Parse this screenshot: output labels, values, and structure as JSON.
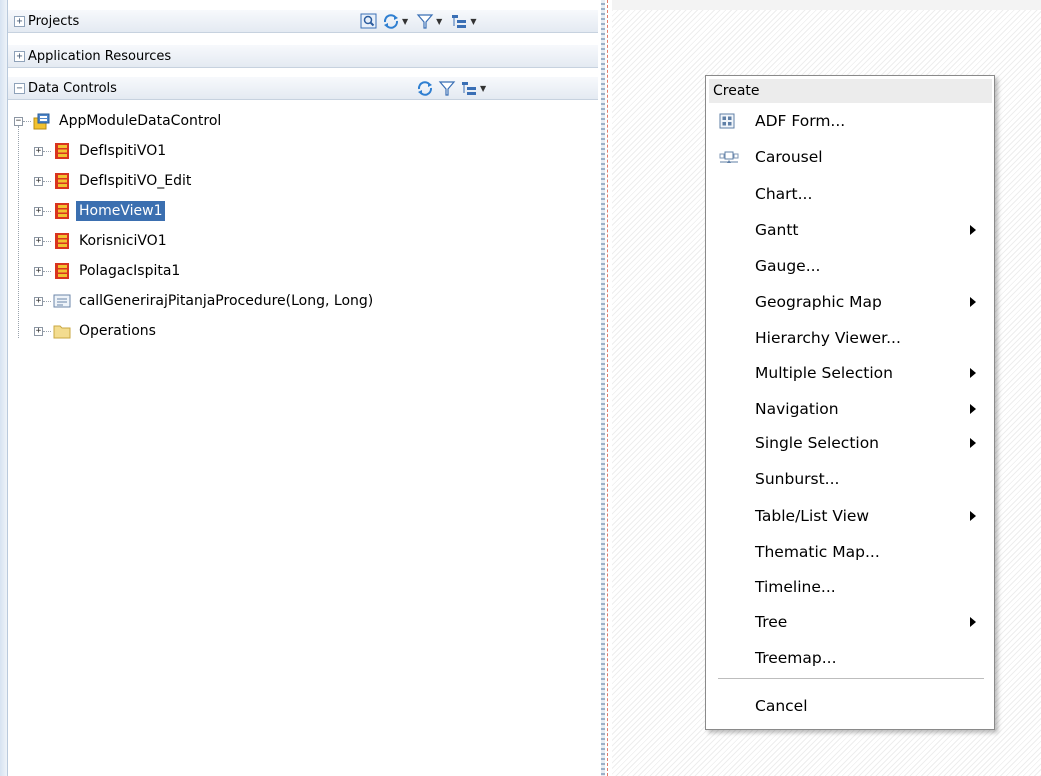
{
  "panels": {
    "projects": {
      "title": "Projects",
      "toggle": "+"
    },
    "app_resources": {
      "title": "Application Resources",
      "toggle": "+"
    },
    "data_controls": {
      "title": "Data Controls",
      "toggle": "−"
    }
  },
  "tree": {
    "root": {
      "label": "AppModuleDataControl",
      "expander": "−",
      "icon": "data-control-icon"
    },
    "children": [
      {
        "label": "DefIspitiVO1",
        "expander": "+",
        "icon": "view-object-icon"
      },
      {
        "label": "DefIspitiVO_Edit",
        "expander": "+",
        "icon": "view-object-icon"
      },
      {
        "label": "HomeView1",
        "expander": "+",
        "icon": "view-object-icon",
        "selected": true
      },
      {
        "label": "KorisniciVO1",
        "expander": "+",
        "icon": "view-object-icon"
      },
      {
        "label": "PolagacIspita1",
        "expander": "+",
        "icon": "view-object-icon"
      },
      {
        "label": "callGenerirajPitanjaProcedure(Long, Long)",
        "expander": "+",
        "icon": "method-icon"
      },
      {
        "label": "Operations",
        "expander": "+",
        "icon": "folder-icon"
      }
    ]
  },
  "menu": {
    "header": "Create",
    "items": [
      {
        "label": "ADF Form...",
        "icon": "form-icon",
        "submenu": false
      },
      {
        "label": "Carousel",
        "icon": "carousel-icon",
        "submenu": false
      },
      {
        "label": "Chart...",
        "submenu": false
      },
      {
        "label": "Gantt",
        "submenu": true
      },
      {
        "label": "Gauge...",
        "submenu": false
      },
      {
        "label": "Geographic Map",
        "submenu": true
      },
      {
        "label": "Hierarchy Viewer...",
        "submenu": false
      },
      {
        "label": "Multiple Selection",
        "submenu": true
      },
      {
        "label": "Navigation",
        "submenu": true
      },
      {
        "label": "Single Selection",
        "submenu": true
      },
      {
        "label": "Sunburst...",
        "submenu": false
      },
      {
        "label": "Table/List View",
        "submenu": true
      },
      {
        "label": "Thematic Map...",
        "submenu": false
      },
      {
        "label": "Timeline...",
        "submenu": false
      },
      {
        "label": "Tree",
        "submenu": true
      },
      {
        "label": "Treemap...",
        "submenu": false
      }
    ],
    "cancel": "Cancel"
  },
  "colors": {
    "selection": "#3b6fb0",
    "view_object_red": "#d9341f",
    "view_object_yellow": "#f2c230"
  }
}
